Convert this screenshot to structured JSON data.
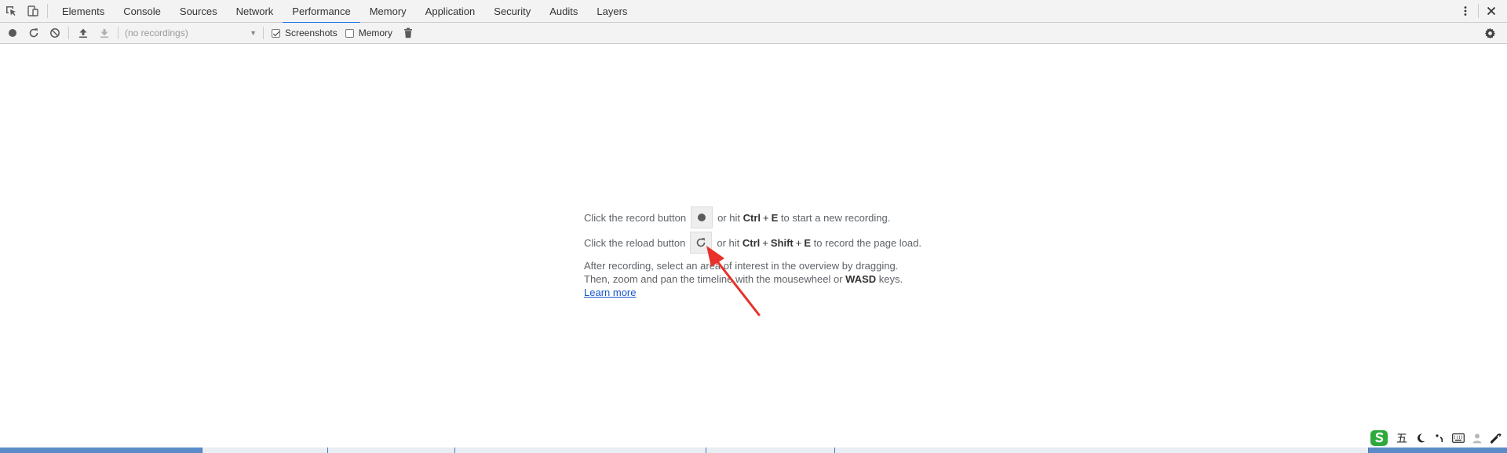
{
  "tabs": [
    {
      "label": "Elements"
    },
    {
      "label": "Console"
    },
    {
      "label": "Sources"
    },
    {
      "label": "Network"
    },
    {
      "label": "Performance",
      "active": true
    },
    {
      "label": "Memory"
    },
    {
      "label": "Application"
    },
    {
      "label": "Security"
    },
    {
      "label": "Audits"
    },
    {
      "label": "Layers"
    }
  ],
  "toolbar": {
    "recordings_placeholder": "(no recordings)",
    "screenshots_label": "Screenshots",
    "screenshots_checked": true,
    "memory_label": "Memory",
    "memory_checked": false
  },
  "landing": {
    "record_prefix": "Click the record button",
    "record_hit": "or hit",
    "record_key1": "Ctrl",
    "record_plus": "+",
    "record_key2": "E",
    "record_suffix": "to start a new recording.",
    "reload_prefix": "Click the reload button",
    "reload_hit": "or hit",
    "reload_key1": "Ctrl",
    "reload_plus1": "+",
    "reload_key2": "Shift",
    "reload_plus2": "+",
    "reload_key3": "E",
    "reload_suffix": "to record the page load.",
    "para_line1": "After recording, select an area of interest in the overview by dragging.",
    "para_line2_a": "Then, zoom and pan the timeline with the mousewheel or",
    "para_line2_key": "WASD",
    "para_line2_b": "keys.",
    "learn_more": "Learn more"
  },
  "ime": {
    "mode_char": "五"
  },
  "colors": {
    "accent": "#1a73e8",
    "arrow": "#e8312a",
    "link": "#1a56c8",
    "ime_logo": "#2eaa3c"
  }
}
